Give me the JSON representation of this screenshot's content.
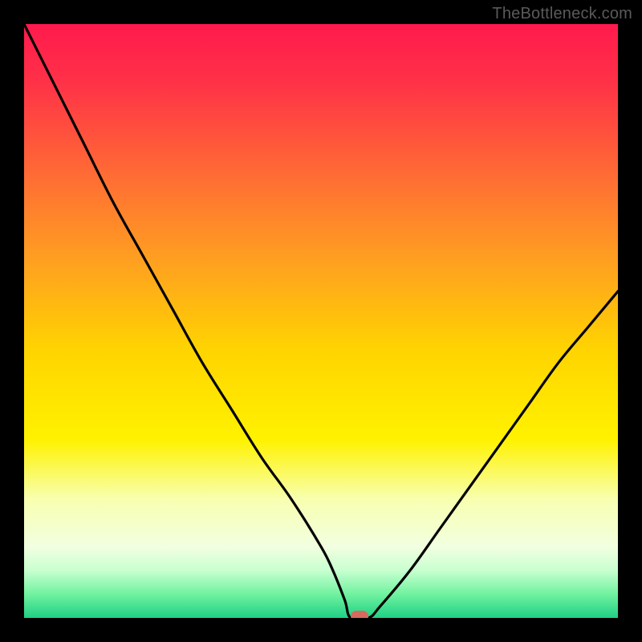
{
  "attribution": "TheBottleneck.com",
  "chart_data": {
    "type": "line",
    "title": "",
    "xlabel": "",
    "ylabel": "",
    "xlim": [
      0,
      100
    ],
    "ylim": [
      0,
      100
    ],
    "x": [
      0,
      5,
      10,
      15,
      20,
      25,
      30,
      35,
      40,
      45,
      50,
      52,
      54,
      55,
      58,
      60,
      65,
      70,
      75,
      80,
      85,
      90,
      95,
      100
    ],
    "values": [
      100,
      90,
      80,
      70,
      61,
      52,
      43,
      35,
      27,
      20,
      12,
      8,
      3,
      0,
      0,
      2,
      8,
      15,
      22,
      29,
      36,
      43,
      49,
      55
    ],
    "marker": {
      "x": 56.5,
      "y": 0,
      "color": "#d66a5f"
    },
    "gradient_stops": [
      {
        "offset": 0.0,
        "color": "#ff1a4d"
      },
      {
        "offset": 0.1,
        "color": "#ff3247"
      },
      {
        "offset": 0.25,
        "color": "#ff6a35"
      },
      {
        "offset": 0.4,
        "color": "#ffa020"
      },
      {
        "offset": 0.55,
        "color": "#ffd400"
      },
      {
        "offset": 0.7,
        "color": "#fff200"
      },
      {
        "offset": 0.8,
        "color": "#f8ffb0"
      },
      {
        "offset": 0.88,
        "color": "#f2ffe0"
      },
      {
        "offset": 0.92,
        "color": "#c8ffd0"
      },
      {
        "offset": 0.96,
        "color": "#70f2a0"
      },
      {
        "offset": 1.0,
        "color": "#1fd084"
      }
    ]
  }
}
